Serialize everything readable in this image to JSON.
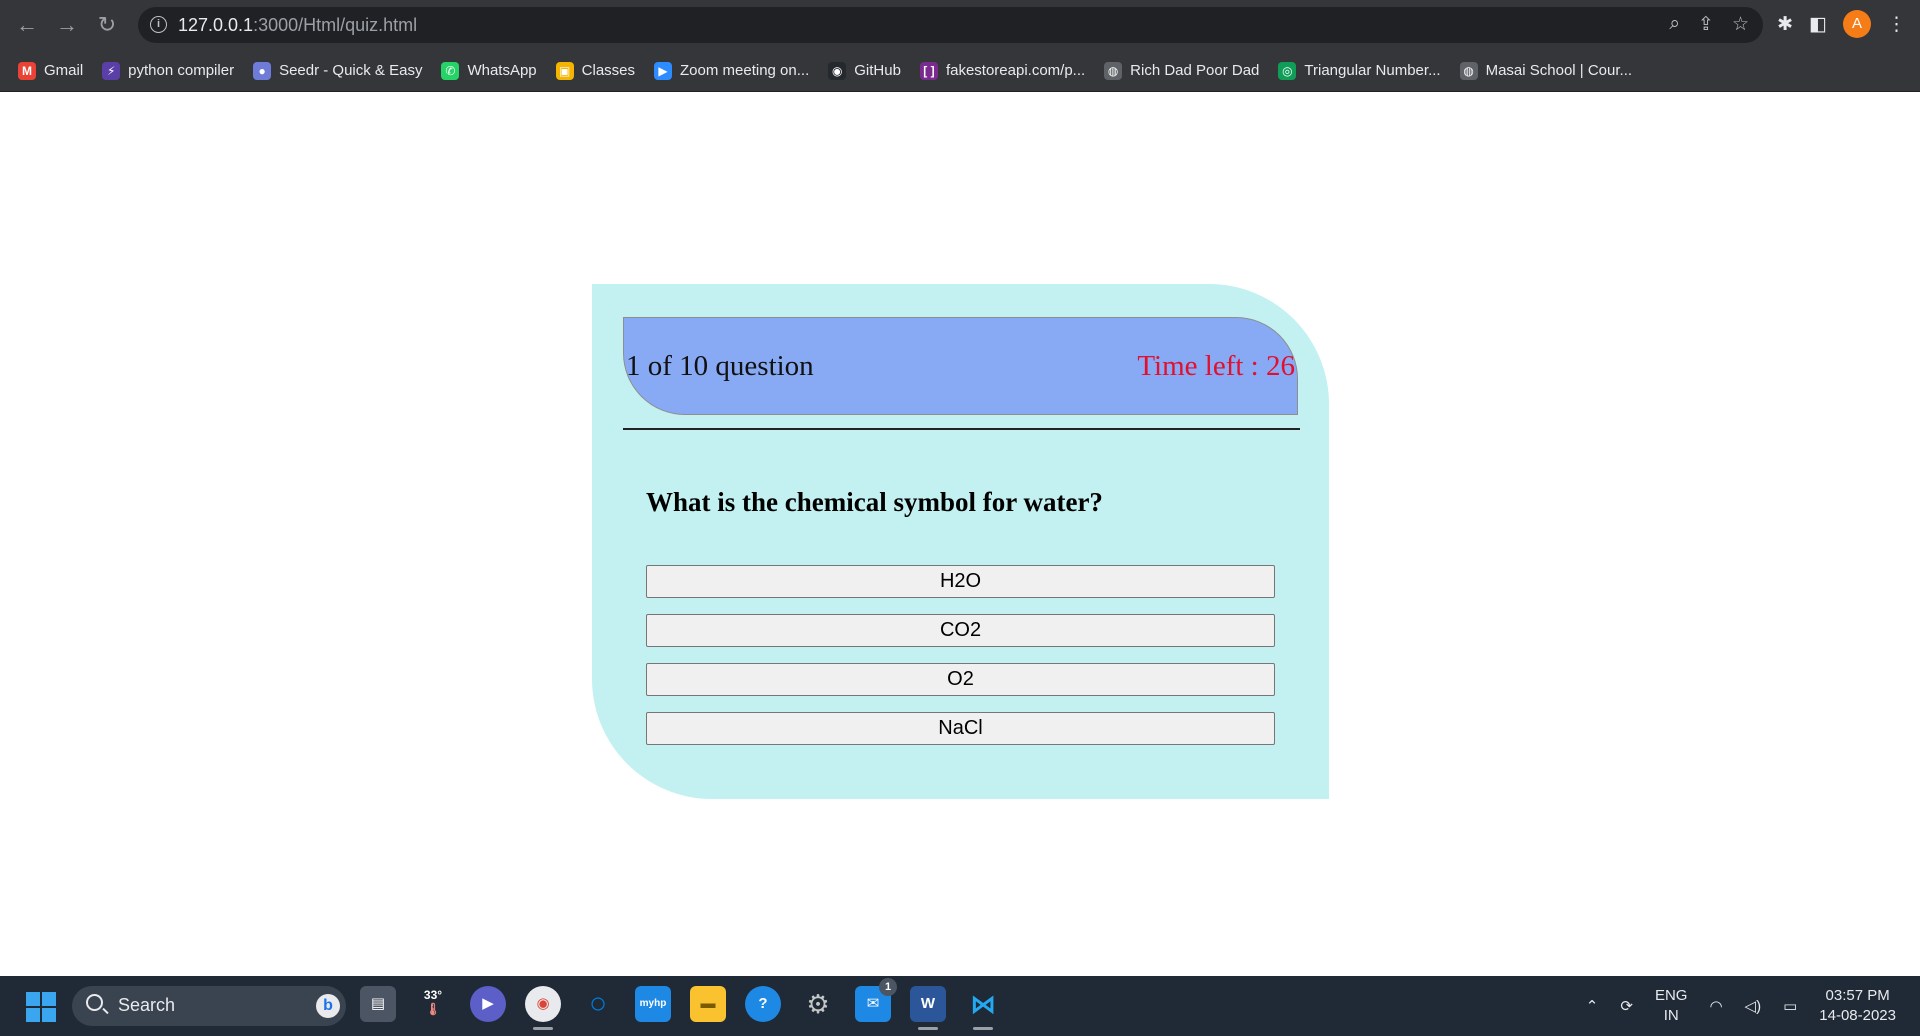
{
  "browser": {
    "url_host": "127.0.0.1",
    "url_path": ":3000/Html/quiz.html",
    "avatar_letter": "A"
  },
  "bookmarks": [
    {
      "label": "Gmail",
      "icon": "gmail-icon",
      "color": "#ea4335",
      "glyph": "M"
    },
    {
      "label": "python compiler",
      "icon": "lightning-icon",
      "color": "#5b3fa8",
      "glyph": "⚡"
    },
    {
      "label": "Seedr - Quick & Easy",
      "icon": "seedr-icon",
      "color": "#6f7bd8",
      "glyph": "●"
    },
    {
      "label": "WhatsApp",
      "icon": "whatsapp-icon",
      "color": "#25d366",
      "glyph": "✆"
    },
    {
      "label": "Classes",
      "icon": "classroom-icon",
      "color": "#f4b400",
      "glyph": "▣"
    },
    {
      "label": "Zoom meeting on...",
      "icon": "zoom-icon",
      "color": "#2d8cff",
      "glyph": "▶"
    },
    {
      "label": "GitHub",
      "icon": "github-icon",
      "color": "#24292e",
      "glyph": "◉"
    },
    {
      "label": "fakestoreapi.com/p...",
      "icon": "fakestore-icon",
      "color": "#7a2b8f",
      "glyph": "[ ]"
    },
    {
      "label": "Rich Dad Poor Dad",
      "icon": "globe-icon",
      "color": "#5f6368",
      "glyph": "◍"
    },
    {
      "label": "Triangular Number...",
      "icon": "owl-icon",
      "color": "#0f9d58",
      "glyph": "◎"
    },
    {
      "label": "Masai School | Cour...",
      "icon": "globe-icon",
      "color": "#5f6368",
      "glyph": "◍"
    }
  ],
  "quiz": {
    "progress": "1 of 10 question",
    "timer": "Time left : 26",
    "question": "What is the chemical symbol for water?",
    "options": [
      "H2O",
      "CO2",
      "O2",
      "NaCl"
    ],
    "colors": {
      "card": "#c3f1f1",
      "header": "#88aaf5",
      "timer": "#e0102e"
    }
  },
  "taskbar": {
    "search_label": "Search",
    "weather": "33°",
    "mail_badge": "1",
    "lang_top": "ENG",
    "lang_bottom": "IN",
    "time": "03:57 PM",
    "date": "14-08-2023"
  }
}
